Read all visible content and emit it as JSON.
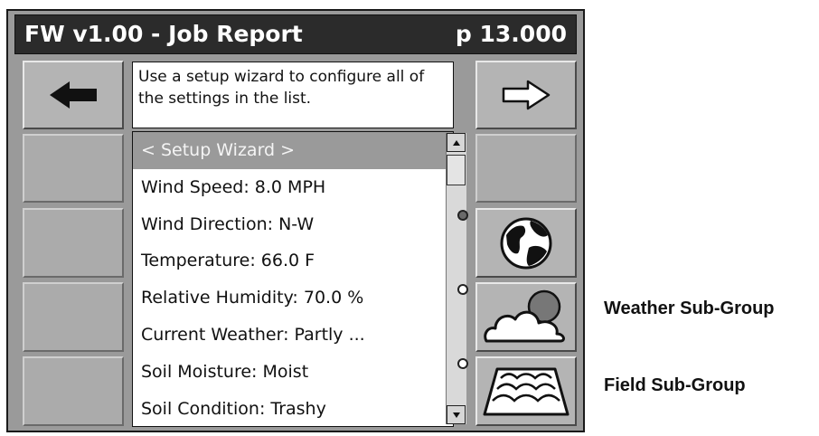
{
  "header": {
    "title": "FW v1.00 - Job Report",
    "page": "p 13.000"
  },
  "help_text": "Use a setup wizard to configure all of the settings in the list.",
  "list": {
    "items": [
      "< Setup Wizard >",
      "Wind Speed: 8.0 MPH",
      "Wind Direction: N-W",
      "Temperature: 66.0 F",
      "Relative Humidity: 70.0 %",
      "Current Weather: Partly ...",
      "Soil Moisture: Moist",
      "Soil Condition: Trashy"
    ],
    "selected_index": 0
  },
  "nav": {
    "back_icon": "left-arrow-icon",
    "forward_icon": "right-arrow-icon"
  },
  "subgroups": [
    {
      "icon": "globe-icon",
      "indicator": "filled"
    },
    {
      "icon": "weather-cloud-sun-icon",
      "indicator": "empty"
    },
    {
      "icon": "field-icon",
      "indicator": "empty"
    }
  ],
  "callouts": {
    "weather": "Weather Sub-Group",
    "field": "Field Sub-Group"
  },
  "colors": {
    "title_bg": "#2b2b2b",
    "panel_bg": "#9a9a9a",
    "selection_bg": "#9a9a9a"
  }
}
